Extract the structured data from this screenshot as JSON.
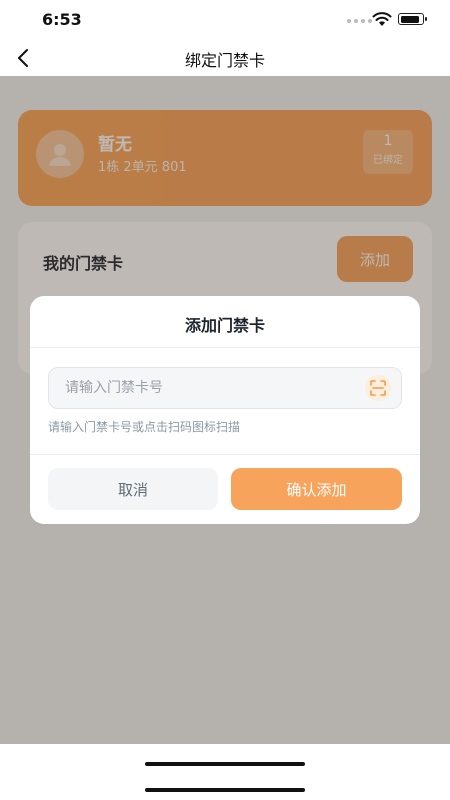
{
  "status_bar": {
    "time": "6:53"
  },
  "nav": {
    "title": "绑定门禁卡",
    "back_icon": "chevron-left-icon"
  },
  "house": {
    "name": "暂无",
    "address": "1栋 2单元 801",
    "bound_count": "1",
    "bound_label": "已绑定",
    "avatar_icon": "user-avatar-icon"
  },
  "card_list": {
    "title": "我的门禁卡",
    "add_label": "添加"
  },
  "dialog": {
    "title": "添加门禁卡",
    "input_placeholder": "请输入门禁卡号",
    "input_value": "",
    "scan_icon": "scan-icon",
    "hint": "请输入门禁卡号或点击扫码图标扫描",
    "cancel_label": "取消",
    "confirm_label": "确认添加"
  },
  "colors": {
    "accent": "#f7a35c",
    "hint": "#8a9aa6",
    "overlay": "rgba(70,55,40,0.35)"
  }
}
